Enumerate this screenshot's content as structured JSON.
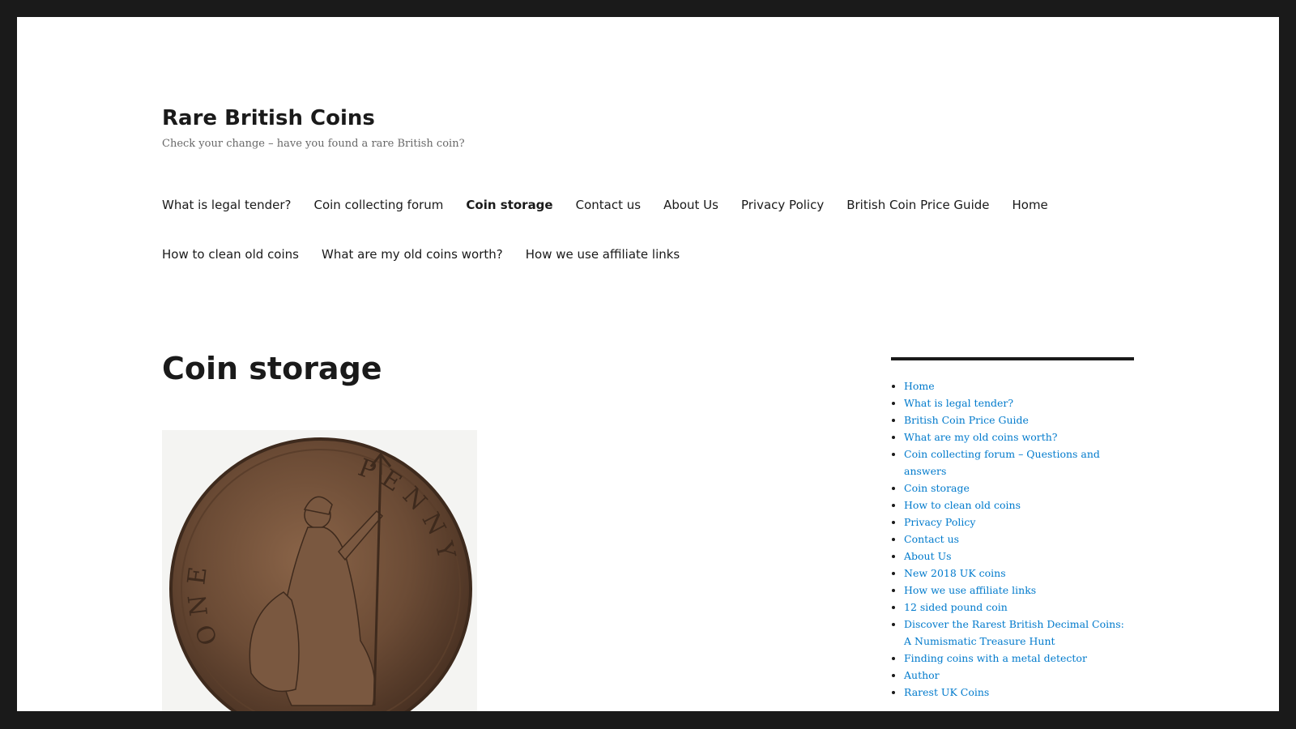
{
  "site": {
    "title": "Rare British Coins",
    "description": "Check your change – have you found a rare British coin?"
  },
  "nav": {
    "items": [
      {
        "label": "What is legal tender?"
      },
      {
        "label": "Coin collecting forum"
      },
      {
        "label": "Coin storage",
        "current": true
      },
      {
        "label": "Contact us"
      },
      {
        "label": "About Us"
      },
      {
        "label": "Privacy Policy"
      },
      {
        "label": "British Coin Price Guide"
      },
      {
        "label": "Home"
      },
      {
        "label": "How to clean old coins"
      },
      {
        "label": "What are my old coins worth?"
      },
      {
        "label": "How we use affiliate links"
      }
    ]
  },
  "page": {
    "title": "Coin storage"
  },
  "coin_image": {
    "legend_left": "ONE",
    "legend_right": "PENNY"
  },
  "sidebar": {
    "links": [
      "Home",
      "What is legal tender?",
      "British Coin Price Guide",
      "What are my old coins worth?",
      "Coin collecting forum – Questions and answers",
      "Coin storage",
      "How to clean old coins",
      "Privacy Policy",
      "Contact us",
      "About Us",
      "New 2018 UK coins",
      "How we use affiliate links",
      "12 sided pound coin",
      "Discover the Rarest British Decimal Coins: A Numismatic Treasure Hunt",
      "Finding coins with a metal detector",
      "Author",
      "Rarest UK Coins"
    ]
  },
  "colors": {
    "frame": "#1a1a1a",
    "text": "#1a1a1a",
    "muted_text": "#686868",
    "link": "#007acc",
    "coin_bronze": "#6b4b35"
  }
}
